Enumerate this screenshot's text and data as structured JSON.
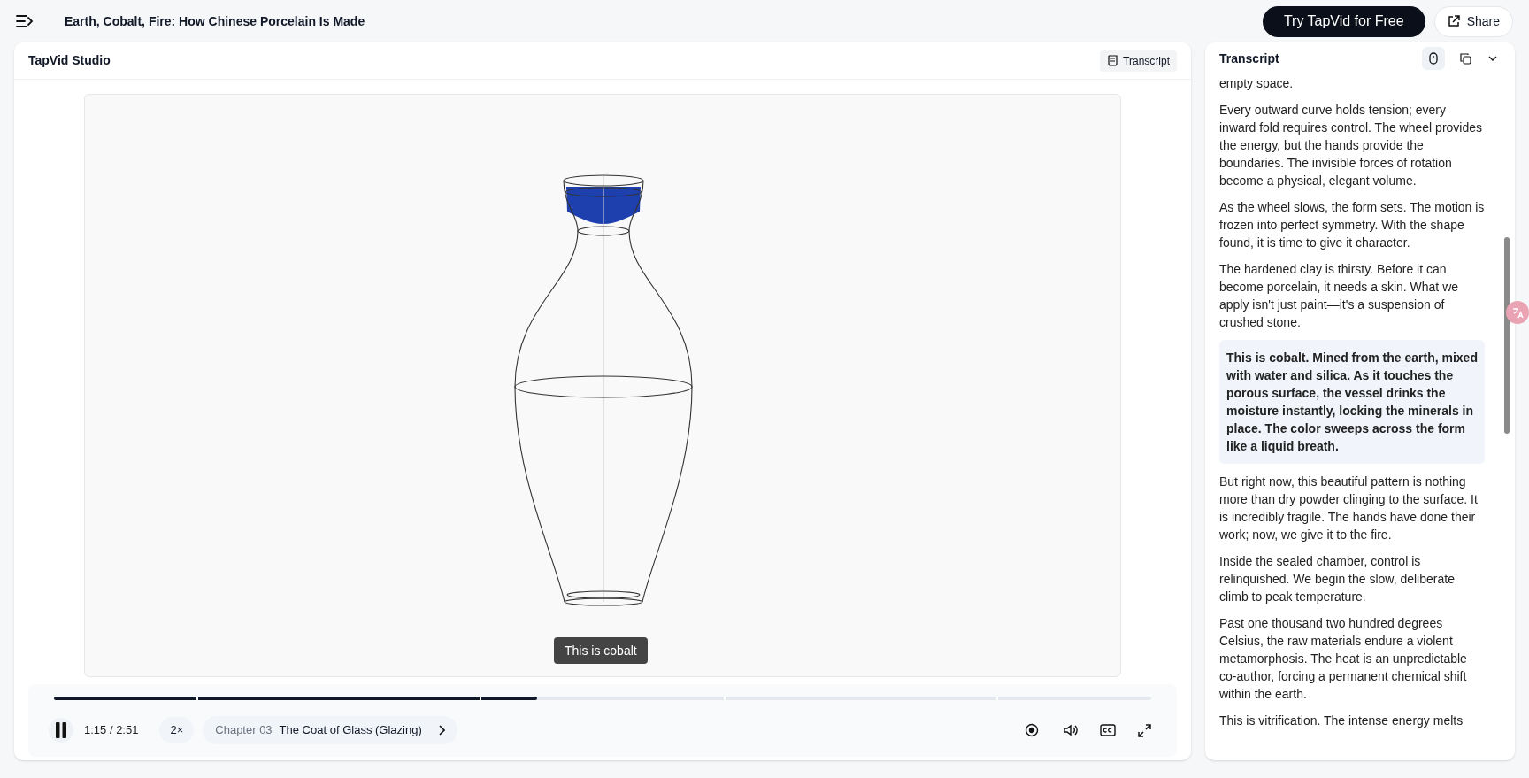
{
  "header": {
    "title": "Earth, Cobalt, Fire: How Chinese Porcelain Is Made",
    "cta": "Try TapVid for Free",
    "share": "Share"
  },
  "player": {
    "title": "TapVid Studio",
    "transcript_button": "Transcript",
    "caption": "This is cobalt",
    "progress": {
      "level": 0.44
    },
    "playing": true,
    "time": "1:15 / 2:51",
    "speed": "2×",
    "chapter_label": "Chapter 03",
    "chapter_title": "The Coat of Glass (Glazing)"
  },
  "transcript": {
    "title": "Transcript",
    "autoscroll": true,
    "paragraphs": [
      {
        "text": "empty space.",
        "selected": false
      },
      {
        "text": "Every outward curve holds tension; every inward fold requires control. The wheel provides the energy, but the hands provide the boundaries. The invisible forces of rotation become a physical, elegant volume.",
        "selected": false
      },
      {
        "text": "As the wheel slows, the form sets. The motion is frozen into perfect symmetry. With the shape found, it is time to give it character.",
        "selected": false
      },
      {
        "text": "The hardened clay is thirsty. Before it can become porcelain, it needs a skin. What we apply isn't just paint—it's a suspension of crushed stone.",
        "selected": false
      },
      {
        "text": "This is cobalt. Mined from the earth, mixed with water and silica. As it touches the porous surface, the vessel drinks the moisture instantly, locking the minerals in place. The color sweeps across the form like a liquid breath.",
        "selected": true
      },
      {
        "text": "But right now, this beautiful pattern is nothing more than dry powder clinging to the surface. It is incredibly fragile. The hands have done their work; now, we give it to the fire.",
        "selected": false
      },
      {
        "text": "Inside the sealed chamber, control is relinquished. We begin the slow, deliberate climb to peak temperature.",
        "selected": false
      },
      {
        "text": "Past one thousand two hundred degrees Celsius, the raw materials endure a violent metamorphosis. The heat is an unpredictable co-author, forcing a permanent chemical shift within the earth.",
        "selected": false
      },
      {
        "text": "This is vitrification. The intense energy melts",
        "selected": false
      }
    ]
  }
}
